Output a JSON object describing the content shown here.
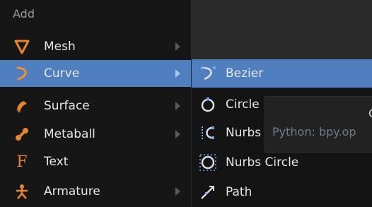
{
  "menu": {
    "title": "Add",
    "items": [
      {
        "label": "Mesh",
        "icon": "mesh-icon"
      },
      {
        "label": "Curve",
        "icon": "curve-icon"
      },
      {
        "label": "Surface",
        "icon": "surface-icon"
      },
      {
        "label": "Metaball",
        "icon": "metaball-icon"
      },
      {
        "label": "Text",
        "icon": "text-icon"
      },
      {
        "label": "Armature",
        "icon": "armature-icon"
      }
    ]
  },
  "submenu": {
    "items": [
      {
        "label": "Bezier",
        "icon": "bezier-icon"
      },
      {
        "label": "Circle",
        "icon": "circle-icon"
      },
      {
        "label": "Nurbs",
        "icon": "nurbs-icon"
      },
      {
        "label": "Nurbs Circle",
        "icon": "nurbs-circle-icon"
      },
      {
        "label": "Path",
        "icon": "path-icon"
      }
    ]
  },
  "tooltip": {
    "title": "C",
    "python": "Python: bpy.op"
  },
  "colors": {
    "highlight": "#4f7fbf",
    "icon_orange": "#e8862b",
    "menu_bg": "#161616",
    "canvas_bg": "#2b2b2b"
  }
}
